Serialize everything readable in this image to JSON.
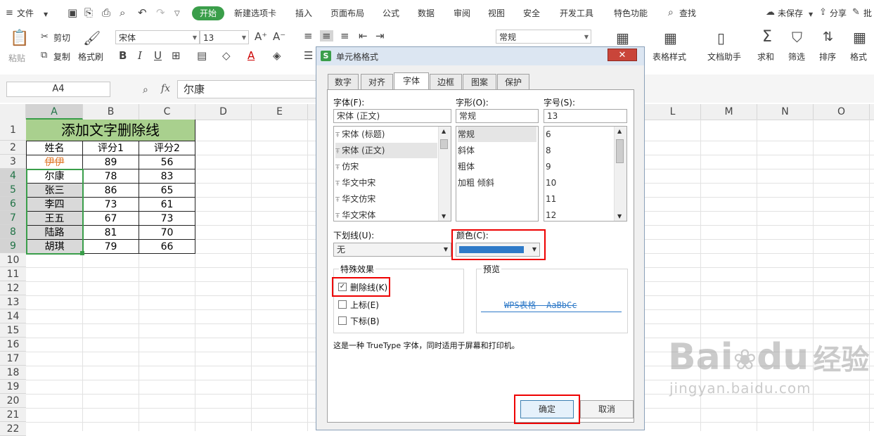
{
  "menubar": {
    "file": "文件",
    "tabs": [
      "开始",
      "新建选项卡",
      "插入",
      "页面布局",
      "公式",
      "数据",
      "审阅",
      "视图",
      "安全",
      "开发工具",
      "特色功能"
    ],
    "search": "查找",
    "unsaved": "未保存",
    "share": "分享",
    "annotate": "批"
  },
  "toolbar": {
    "paste": "粘贴",
    "cut": "剪切",
    "copy": "复制",
    "format_painter": "格式刷",
    "font_name": "宋体",
    "font_size": "13",
    "number_format": "常规",
    "table_style": "表格样式",
    "doc_helper": "文档助手",
    "sum": "求和",
    "filter": "筛选",
    "sort": "排序",
    "format": "格式"
  },
  "formula_bar": {
    "name_box": "A4",
    "fx": "fx",
    "value": "尔康"
  },
  "columns": [
    "A",
    "B",
    "C",
    "D",
    "E",
    "L",
    "M",
    "N",
    "O"
  ],
  "rows": [
    "1",
    "2",
    "3",
    "4",
    "5",
    "6",
    "7",
    "8",
    "9",
    "10",
    "11",
    "12",
    "13",
    "14",
    "15",
    "16",
    "17",
    "18",
    "19",
    "20",
    "21",
    "22"
  ],
  "sheet": {
    "title": "添加文字删除线",
    "headers": [
      "姓名",
      "评分1",
      "评分2"
    ],
    "data": [
      [
        "伊伊",
        "89",
        "56"
      ],
      [
        "尔康",
        "78",
        "83"
      ],
      [
        "张三",
        "86",
        "65"
      ],
      [
        "李四",
        "73",
        "61"
      ],
      [
        "王五",
        "67",
        "73"
      ],
      [
        "陆路",
        "81",
        "70"
      ],
      [
        "胡琪",
        "79",
        "66"
      ]
    ]
  },
  "dialog": {
    "title": "单元格格式",
    "tabs": [
      "数字",
      "对齐",
      "字体",
      "边框",
      "图案",
      "保护"
    ],
    "font_label": "字体(F):",
    "font_value": "宋体 (正文)",
    "fonts": [
      "宋体 (标题)",
      "宋体 (正文)",
      "仿宋",
      "华文中宋",
      "华文仿宋",
      "华文宋体"
    ],
    "style_label": "字形(O):",
    "style_value": "常规",
    "styles": [
      "常规",
      "斜体",
      "粗体",
      "加粗 倾斜"
    ],
    "size_label": "字号(S):",
    "size_value": "13",
    "sizes": [
      "6",
      "8",
      "9",
      "10",
      "11",
      "12"
    ],
    "underline_label": "下划线(U):",
    "underline_value": "无",
    "color_label": "颜色(C):",
    "color_value": "#2f7ac8",
    "effects_label": "特殊效果",
    "strikethrough": "删除线(K)",
    "superscript": "上标(E)",
    "subscript": "下标(B)",
    "preview_label": "预览",
    "preview_text": "WPS表格  AaBbCc",
    "info": "这是一种 TrueType 字体，同时适用于屏幕和打印机。",
    "ok": "确定",
    "cancel": "取消"
  },
  "watermark": {
    "brand": "Bai",
    "brand2": "du",
    "cn": "经验",
    "url": "jingyan.baidu.com"
  },
  "colors": {
    "accent": "#3a9e4a",
    "header_fill": "#a9d08e",
    "highlight": "#e00000",
    "strike": "#e07a2e"
  }
}
